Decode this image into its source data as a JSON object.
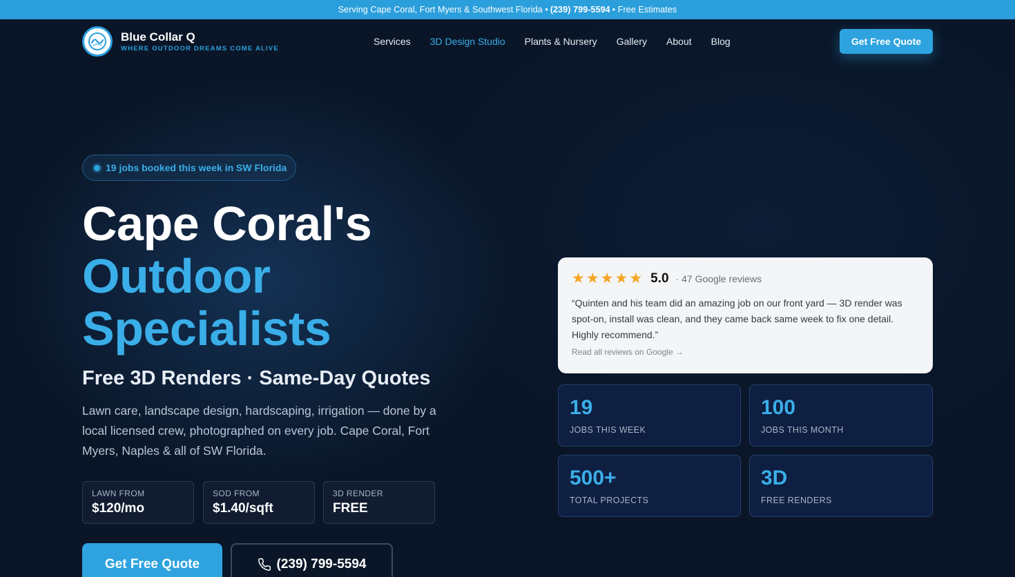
{
  "topbar": {
    "prefix": "Serving Cape Coral, Fort Myers & Southwest Florida •",
    "phone": "(239) 799-5594",
    "suffix": "• Free Estimates"
  },
  "header": {
    "brand_name": "Blue Collar Q",
    "brand_tagline": "WHERE OUTDOOR DREAMS COME ALIVE",
    "nav": [
      {
        "label": "Services",
        "active": false
      },
      {
        "label": "3D Design Studio",
        "active": true
      },
      {
        "label": "Plants & Nursery",
        "active": false
      },
      {
        "label": "Gallery",
        "active": false
      },
      {
        "label": "About",
        "active": false
      },
      {
        "label": "Blog",
        "active": false
      }
    ],
    "cta_label": "Get Free Quote"
  },
  "hero": {
    "badge": "19 jobs booked this week in SW Florida",
    "headline_line1": "Cape Coral's",
    "headline_line2": "Outdoor",
    "headline_line3": "Specialists",
    "subhead": "Free 3D Renders · Same-Day Quotes",
    "description": "Lawn care, landscape design, hardscaping, irrigation — done by a local licensed crew, photographed on every job. Cape Coral, Fort Myers, Naples & all of SW Florida.",
    "prices": [
      {
        "label": "LAWN FROM",
        "value": "$120/mo"
      },
      {
        "label": "SOD FROM",
        "value": "$1.40/sqft"
      },
      {
        "label": "3D RENDER",
        "value": "FREE"
      }
    ],
    "cta_primary": "Get Free Quote",
    "cta_phone": "(239) 799-5594"
  },
  "review": {
    "stars": 5,
    "rating": "5.0",
    "count": "· 47 Google reviews",
    "quote": "“Quinten and his team did an amazing job on our front yard — 3D render was spot-on, install was clean, and they came back same week to fix one detail. Highly recommend.”",
    "link": "Read all reviews on Google →"
  },
  "stats": [
    {
      "value": "19",
      "label": "JOBS THIS WEEK"
    },
    {
      "value": "100",
      "label": "JOBS THIS MONTH"
    },
    {
      "value": "500+",
      "label": "TOTAL PROJECTS"
    },
    {
      "value": "3D",
      "label": "FREE RENDERS"
    }
  ],
  "colors": {
    "accent": "#2ea3e0",
    "background": "#0a1628",
    "star": "#f5a623"
  }
}
